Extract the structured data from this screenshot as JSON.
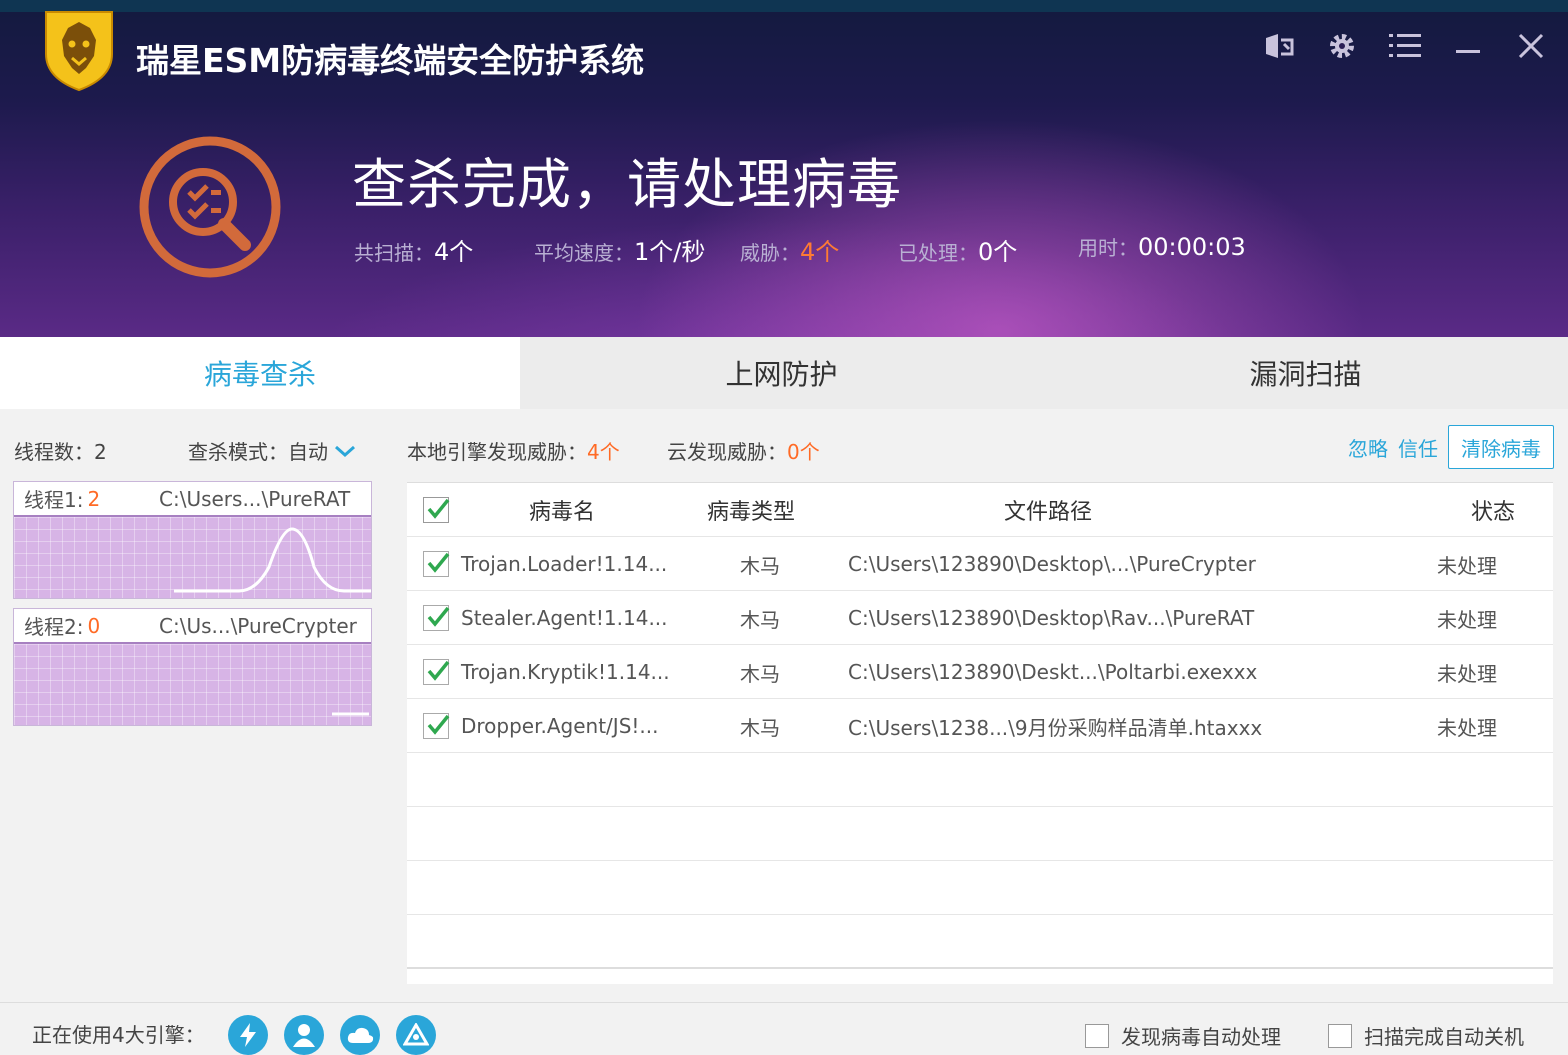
{
  "app": {
    "title": "瑞星ESM防病毒终端安全防护系统"
  },
  "status": {
    "title": "查杀完成，请处理病毒",
    "total_label": "共扫描：",
    "total_value": "4个",
    "speed_label": "平均速度：",
    "speed_value": "1个/秒",
    "threat_label": "威胁：",
    "threat_value": "4个",
    "handled_label": "已处理：",
    "handled_value": "0个",
    "time_label": "用时：",
    "time_value": "00:00:03"
  },
  "tabs": [
    {
      "label": "病毒查杀",
      "active": true
    },
    {
      "label": "上网防护",
      "active": false
    },
    {
      "label": "漏洞扫描",
      "active": false
    }
  ],
  "left": {
    "thread_count": "线程数：2",
    "scan_mode": "查杀模式：自动",
    "threads": [
      {
        "label": "线程1:",
        "count": "2",
        "path": "C:\\Users...\\PureRAT"
      },
      {
        "label": "线程2:",
        "count": "0",
        "path": "C:\\Us...\\PureCrypter"
      }
    ]
  },
  "right": {
    "local_label": "本地引擎发现威胁：",
    "local_value": "4个",
    "cloud_label": "云发现威胁：",
    "cloud_value": "0个",
    "ignore": "忽略",
    "trust": "信任",
    "clean": "清除病毒"
  },
  "table": {
    "headers": {
      "name": "病毒名",
      "type": "病毒类型",
      "path": "文件路径",
      "status": "状态"
    },
    "rows": [
      {
        "name": "Trojan.Loader!1.14...",
        "type": "木马",
        "path": "C:\\Users\\123890\\Desktop\\...\\PureCrypter",
        "status": "未处理"
      },
      {
        "name": "Stealer.Agent!1.14...",
        "type": "木马",
        "path": "C:\\Users\\123890\\Desktop\\Rav...\\PureRAT",
        "status": "未处理"
      },
      {
        "name": "Trojan.Kryptik!1.14...",
        "type": "木马",
        "path": "C:\\Users\\123890\\Deskt...\\Poltarbi.exexxx",
        "status": "未处理"
      },
      {
        "name": "Dropper.Agent/JS!...",
        "type": "木马",
        "path": "C:\\Users\\1238...\\9月份采购样品清单.htaxxx",
        "status": "未处理"
      }
    ]
  },
  "footer": {
    "engines_label": "正在使用4大引擎：",
    "auto_handle": "发现病毒自动处理",
    "auto_shutdown": "扫描完成自动关机"
  },
  "colors": {
    "accent": "#2aa6d9",
    "warn": "#ff6a25",
    "graph": "#d7b4e6"
  }
}
